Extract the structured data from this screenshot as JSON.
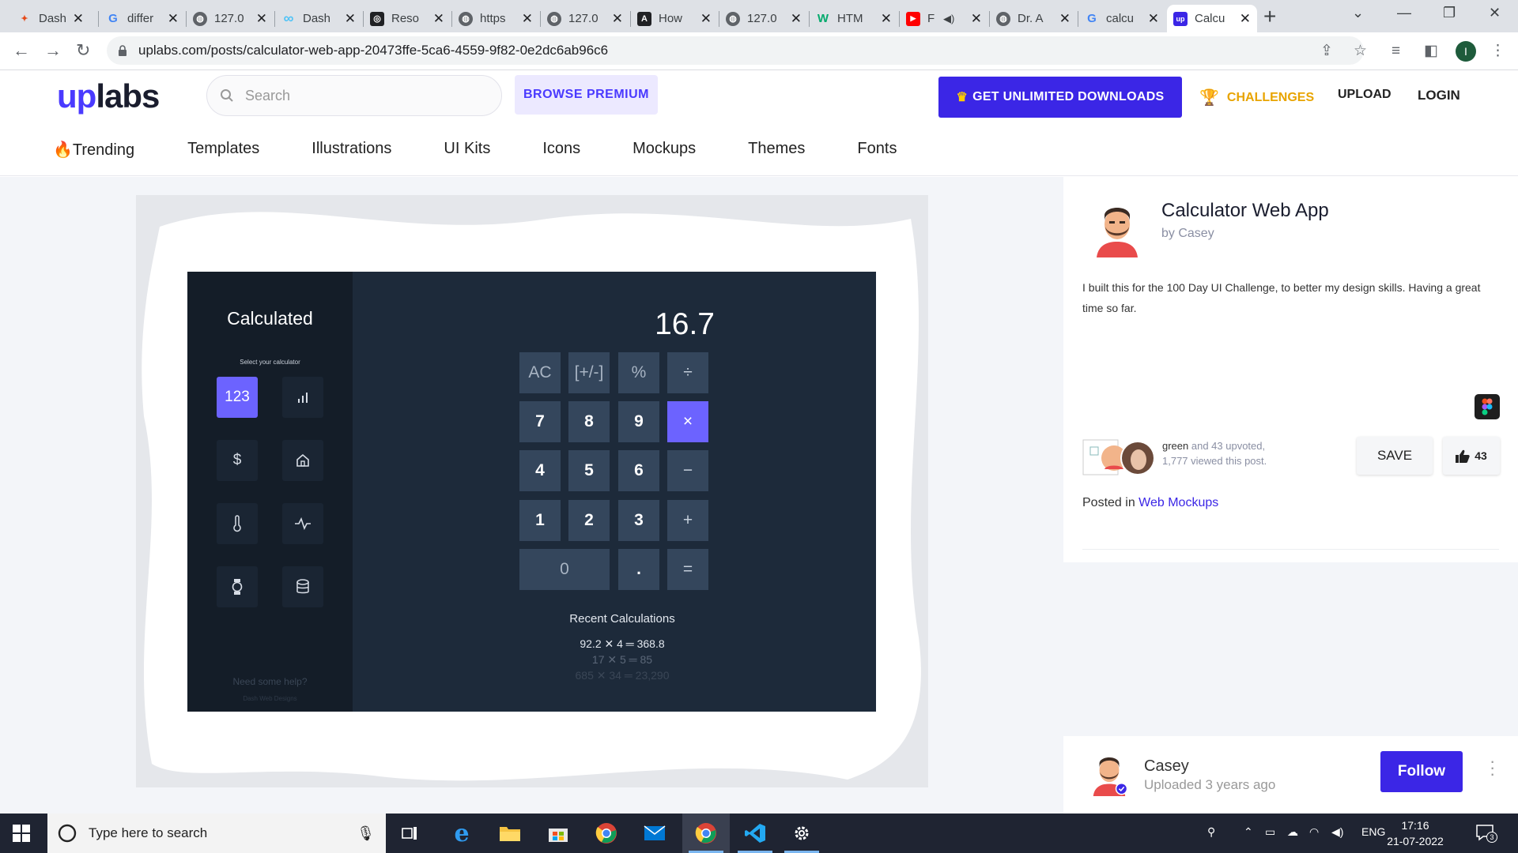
{
  "browser": {
    "tabs": [
      {
        "title": "Dash",
        "icon": "dash-app-icon",
        "active": false
      },
      {
        "title": "differ",
        "icon": "google-icon",
        "active": false
      },
      {
        "title": "127.0",
        "icon": "globe-icon",
        "active": false
      },
      {
        "title": "Dash",
        "icon": "infinity-icon",
        "active": false
      },
      {
        "title": "Reso",
        "icon": "resource-icon",
        "active": false
      },
      {
        "title": "https",
        "icon": "globe-icon",
        "active": false
      },
      {
        "title": "127.0",
        "icon": "globe-icon",
        "active": false
      },
      {
        "title": "How",
        "icon": "a-logo-icon",
        "active": false
      },
      {
        "title": "127.0",
        "icon": "globe-icon",
        "active": false
      },
      {
        "title": "HTM",
        "icon": "w-logo-icon",
        "active": false
      },
      {
        "title": "F",
        "icon": "youtube-icon",
        "active": false
      },
      {
        "title": "Dr. A",
        "icon": "globe-icon",
        "active": false
      },
      {
        "title": "calcu",
        "icon": "google-icon",
        "active": false
      },
      {
        "title": "Calcu",
        "icon": "uplabs-icon",
        "active": true
      }
    ],
    "url": "uplabs.com/posts/calculator-web-app-20473ffe-5ca6-4559-9f82-0e2dc6ab96c6",
    "profile_initial": "I"
  },
  "site": {
    "logo_up": "up",
    "logo_labs": "labs",
    "search_placeholder": "Search",
    "browse_premium": "BROWSE PREMIUM",
    "get_unlimited": "GET UNLIMITED DOWNLOADS",
    "challenges": "CHALLENGES",
    "upload": "UPLOAD",
    "login": "LOGIN",
    "categories": [
      "Trending",
      "Templates",
      "Illustrations",
      "UI Kits",
      "Icons",
      "Mockups",
      "Themes",
      "Fonts"
    ]
  },
  "calculator": {
    "title": "Calculated",
    "select_label": "Select your calculator",
    "selected_mode": "123",
    "display": "16.7",
    "keys": [
      [
        "AC",
        "[+/-]",
        "%",
        "÷"
      ],
      [
        "7",
        "8",
        "9",
        "×"
      ],
      [
        "4",
        "5",
        "6",
        "−"
      ],
      [
        "1",
        "2",
        "3",
        "+"
      ],
      [
        "0",
        ".",
        "="
      ]
    ],
    "recent_title": "Recent Calculations",
    "recent": [
      "92.2 ✕ 4 ═ 368.8",
      "17 ✕ 5 ═ 85",
      "685 ✕ 34 ═ 23,290"
    ],
    "help": "Need some help?",
    "credit": "Dash Web Designs"
  },
  "post": {
    "title": "Calculator Web App",
    "byline": "by Casey",
    "description": "I built this for the 100 Day UI Challenge, to better my design skills. Having a great time so far.",
    "upvoter": "green",
    "upvote_rest": " and 43 upvoted,",
    "views": "1,777 viewed this post.",
    "save": "SAVE",
    "likes": "43",
    "posted_in_label": "Posted in ",
    "posted_in_link": "Web Mockups"
  },
  "author": {
    "name": "Casey",
    "uploaded": "Uploaded 3 years ago",
    "follow": "Follow"
  },
  "taskbar": {
    "search_placeholder": "Type here to search",
    "lang": "ENG",
    "time": "17:16",
    "date": "21-07-2022",
    "notif_count": "3"
  },
  "colors": {
    "brand": "#3b26e6",
    "calc_accent": "#6c63ff",
    "calc_bg": "#1d2a3a",
    "challenge": "#e8a400"
  }
}
